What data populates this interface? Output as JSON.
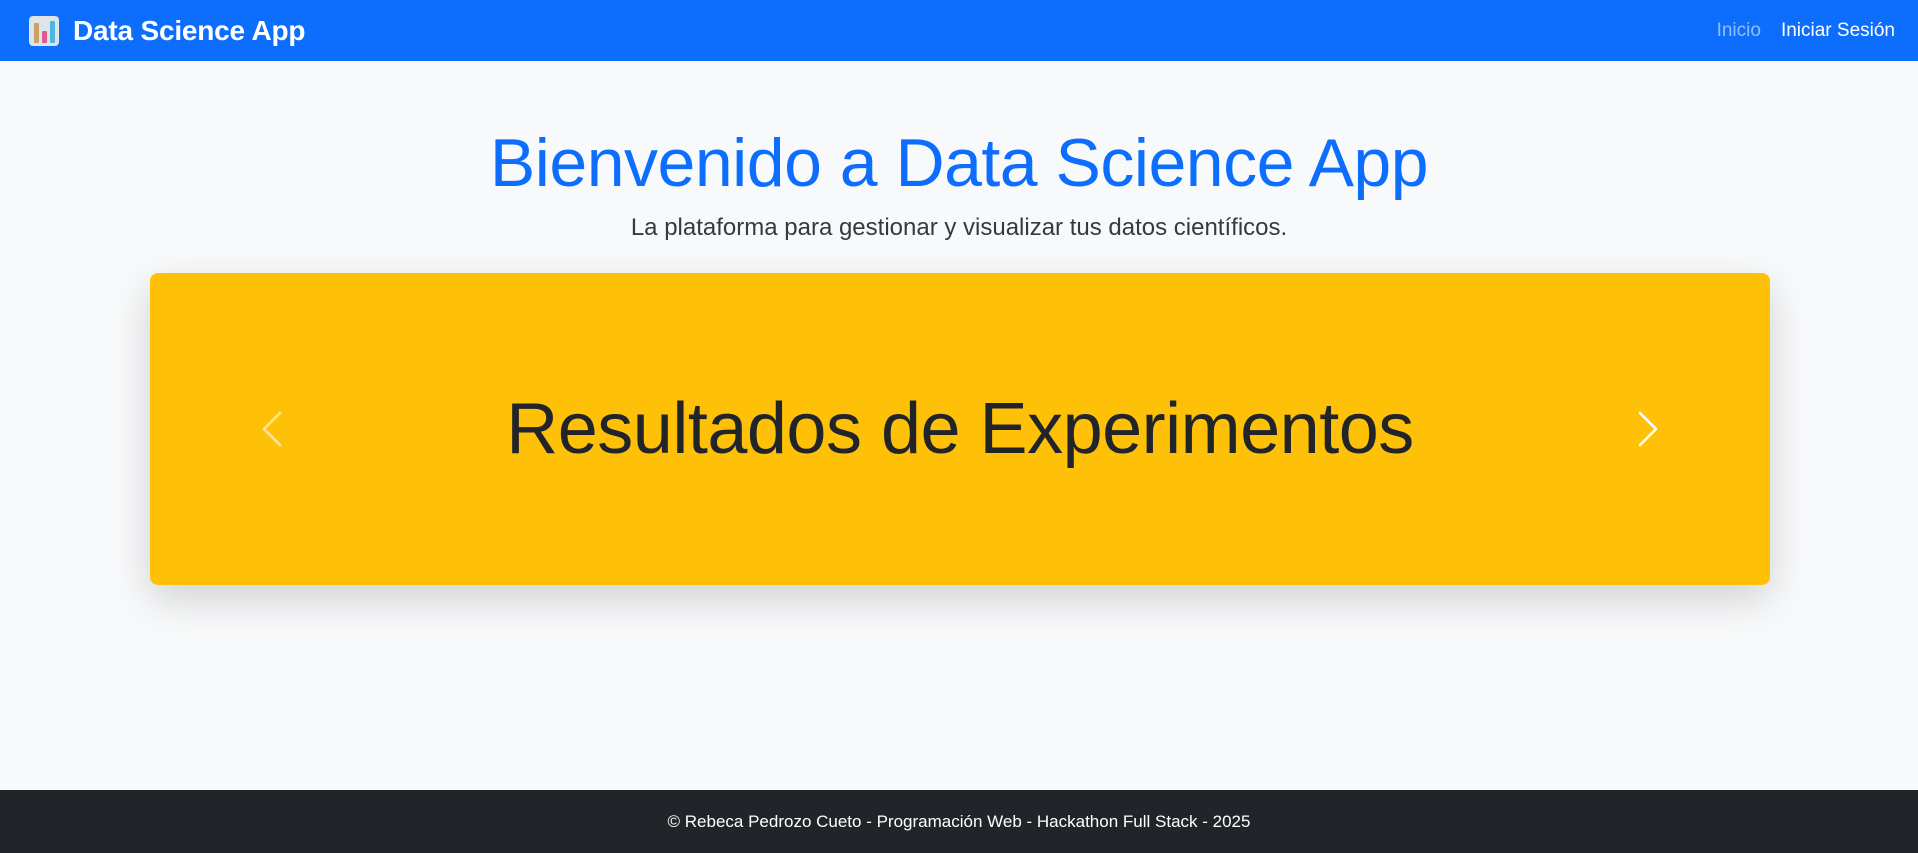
{
  "navbar": {
    "brand_icon": "bar-chart-icon",
    "brand": "Data Science App",
    "links": [
      {
        "label": "Inicio"
      },
      {
        "label": "Iniciar Sesión"
      }
    ],
    "background_color": "#0d6efd"
  },
  "hero": {
    "title": "Bienvenido a Data Science App",
    "subtitle": "La plataforma para gestionar y visualizar tus datos científicos."
  },
  "carousel": {
    "slide_title": "Resultados de Experimentos",
    "slide_color": "#ffc107",
    "prev_icon": "chevron-left-icon",
    "next_icon": "chevron-right-icon"
  },
  "footer": {
    "text": "© Rebeca Pedrozo Cueto - Programación Web - Hackathon Full Stack - 2025"
  }
}
